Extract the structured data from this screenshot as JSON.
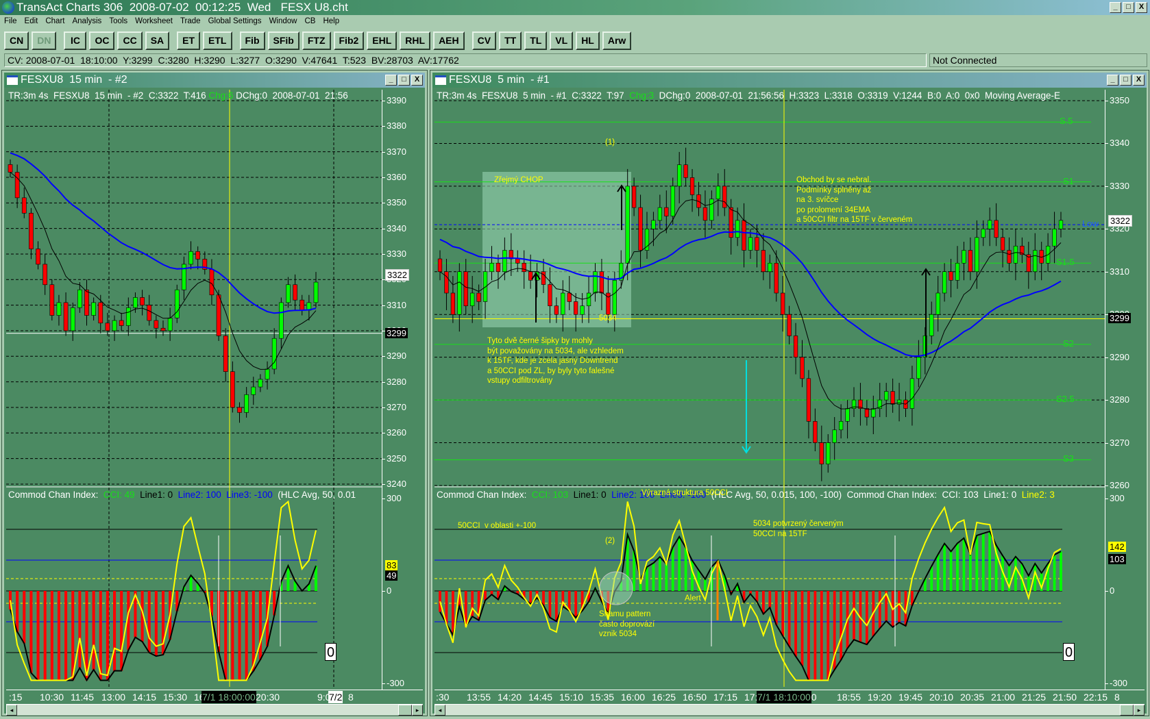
{
  "app": {
    "title": "TransAct Charts 306  2008-07-02  00:12:25  Wed   FESX U8.cht",
    "menu": [
      "File",
      "Edit",
      "Chart",
      "Analysis",
      "Tools",
      "Worksheet",
      "Trade",
      "Global Settings",
      "Window",
      "CB",
      "Help"
    ],
    "toolbar": [
      [
        "CN",
        "DN"
      ],
      [
        "IC",
        "OC",
        "CC",
        "SA"
      ],
      [
        "ET",
        "ETL"
      ],
      [
        "Fib",
        "SFib",
        "FTZ",
        "Fib2",
        "EHL",
        "RHL",
        "AEH"
      ],
      [
        "CV",
        "TT",
        "TL",
        "VL",
        "HL",
        "Arw"
      ]
    ],
    "status": "CV: 2008-07-01  18:10:00  Y:3299  C:3280  H:3290  L:3277  O:3290  V:47641  T:523  BV:28703  AV:17762",
    "connection": "Not Connected",
    "win_buttons": [
      "_",
      "□",
      "X"
    ]
  },
  "left": {
    "title": "FESXU8  15 min  - #2",
    "info": {
      "a": "TR:3m 4s  FESXU8  15 min  - #2  C:3322  T:416 ",
      "chg": "Chg:6",
      "b": " DChg:0  2008-07-01  21:56"
    },
    "cci_info": {
      "name": "Commod Chan Index:  ",
      "cci": "CCI: 49",
      "line1": "  Line1: 0  ",
      "line2": "Line2: 100",
      "line3": "  Line3: -100",
      "params": "  (HLC Avg, 50, 0.01"
    },
    "price_labels": [
      "3390",
      "3380",
      "3370",
      "3360",
      "3350",
      "3340",
      "3330",
      "3320",
      "3310",
      "3300",
      "3290",
      "3280",
      "3270",
      "3260",
      "3250",
      "3240"
    ],
    "last_price": "3322",
    "cursor_price": "3299",
    "cci_labels": [
      "300",
      "0",
      "-300"
    ],
    "cci_yellow": "83",
    "cci_black": "49",
    "zero_box": "0",
    "time_labels": [
      ":15",
      "10:30",
      "11:45",
      "13:00",
      "14:15",
      "15:30",
      "16:4",
      ":15",
      "20:30",
      "",
      "9:00",
      "8"
    ],
    "cursor_time": "7/1 18:00:00",
    "date_box": "7/2",
    "closes": [
      3362,
      3352,
      3346,
      3332,
      3326,
      3318,
      3306,
      3311,
      3300,
      3309,
      3316,
      3306,
      3311,
      3303,
      3300,
      3304,
      3302,
      3309,
      3313,
      3310,
      3304,
      3301,
      3300,
      3305,
      3316,
      3326,
      3331,
      3328,
      3324,
      3314,
      3298,
      3284,
      3270,
      3268,
      3275,
      3278,
      3281,
      3285,
      3297,
      3311,
      3318,
      3312,
      3308,
      3311,
      3319
    ]
  },
  "right": {
    "title": "FESXU8  5 min  - #1",
    "info": {
      "a": "TR:3m 4s  FESXU8  5 min  - #1  C:3322  T:97  ",
      "chg": "Chg:3",
      "b": "  DChg:0  2008-07-01  21:56:56  H:3323  L:3318  O:3319  V:1244  B:0  A:0  0x0  Moving Average-E"
    },
    "cci_info": {
      "name": "Commod Chan Index:  ",
      "cci": "CCI: 103",
      "line1": "  Line1: 0  ",
      "line2": "Line2: 100",
      "line3": "  Line3: -100",
      "params": "  (HLC Avg, 50, 0.015, 100, -100)  Commod Chan Index:  CCI: 103  Line1: 0  ",
      "line2b": "Line2: 3"
    },
    "price_labels": [
      "3350",
      "3340",
      "3330",
      "3320",
      "3310",
      "3300",
      "3290",
      "3280",
      "3270",
      "3260"
    ],
    "last_price": "3322",
    "cursor_price": "3299",
    "cci_labels": [
      "300",
      "0",
      "-300"
    ],
    "cci_yellow": "142",
    "cci_black": "103",
    "zero_box": "0",
    "levels": [
      {
        "label": "S.5",
        "price": 3345
      },
      {
        "label": "S1",
        "price": 3331
      },
      {
        "label": "S1.5",
        "price": 3312
      },
      {
        "label": "S2",
        "price": 3293
      },
      {
        "label": "S2.5",
        "price": 3280
      },
      {
        "label": "S3",
        "price": 3266
      }
    ],
    "low_label": "Low",
    "time_labels": [
      ":30",
      "13:55",
      "14:20",
      "14:45",
      "15:10",
      "15:35",
      "16:00",
      "16:25",
      "16:50",
      "17:15",
      "17:40",
      "",
      "30",
      "18:55",
      "19:20",
      "19:45",
      "20:10",
      "20:35",
      "21:00",
      "21:25",
      "21:50",
      "22:15",
      "8"
    ],
    "cursor_time": "7/1 18:10:00",
    "annotations": {
      "chop": "Zřejmý CHOP",
      "one": "(1)",
      "p5034": "5034",
      "filter_note": "Tyto dvě černé šipky by mohly\nbýt považovány na 5034, ale vzhledem\nk 15TF, kde je zcela jasný Downtrend\na 50CCI pod ZL, by byly tyto falešné\nvstupy odfiltrovány",
      "trade_note": "Obchod by se nebral.\nPodmínky splněny až\nna 3. svíčce\npo prolomení 34EMA\na 50CCI filtr na 15TF v červeném",
      "structure": "Výrazná struktura 50CCI",
      "range": "50CCI  v oblasti +-100",
      "two": "(2)",
      "shamu": "Shamu pattern\nčasto doprovází\nvznik 5034",
      "alert": "Alert",
      "confirmed": "5034 potvrzený červeným\n50CCI na 15TF"
    },
    "closes": [
      3310,
      3305,
      3300,
      3310,
      3302,
      3305,
      3303,
      3310,
      3312,
      3310,
      3315,
      3313,
      3312,
      3310,
      3308,
      3310,
      3307,
      3302,
      3300,
      3305,
      3303,
      3300,
      3302,
      3305,
      3310,
      3305,
      3300,
      3308,
      3312,
      3330,
      3325,
      3315,
      3320,
      3322,
      3325,
      3323,
      3330,
      3335,
      3332,
      3328,
      3325,
      3322,
      3327,
      3330,
      3325,
      3318,
      3322,
      3315,
      3318,
      3315,
      3310,
      3312,
      3305,
      3300,
      3295,
      3290,
      3285,
      3275,
      3270,
      3265,
      3270,
      3273,
      3275,
      3278,
      3280,
      3278,
      3276,
      3278,
      3280,
      3282,
      3279,
      3280,
      3278,
      3285,
      3290,
      3295,
      3300,
      3305,
      3310,
      3308,
      3312,
      3315,
      3310,
      3318,
      3320,
      3322,
      3318,
      3315,
      3312,
      3316,
      3314,
      3310,
      3315,
      3312,
      3316,
      3320,
      3322
    ]
  },
  "colors": {
    "bg": "#4b8a62",
    "up": "#00ff00",
    "down": "#ff0000",
    "ema_slow": "#0000ff",
    "ema_fast": "#000000",
    "cci_fast": "#ffff00",
    "level": "#18e018"
  }
}
